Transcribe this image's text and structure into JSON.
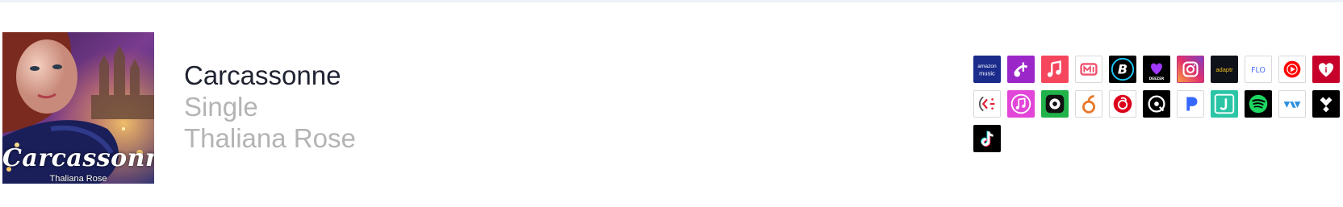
{
  "release": {
    "title": "Carcassonne",
    "type": "Single",
    "artist": "Thaliana Rose",
    "cover_title": "Carcassonne",
    "cover_artist": "Thaliana Rose"
  },
  "services": [
    {
      "name": "amazon-music-icon",
      "label_line1": "amazon",
      "label_line2": "music",
      "bg": "#1a2b8c",
      "fg": "#ffffff"
    },
    {
      "name": "anghami-icon",
      "bg": "#9c27c9",
      "fg": "#ffffff"
    },
    {
      "name": "apple-music-icon",
      "bg": "#f5465d",
      "fg": "#ffffff"
    },
    {
      "name": "audiomack-icon",
      "bg": "#ffffff",
      "fg": "#f0506e"
    },
    {
      "name": "boomplay-icon",
      "bg": "#000000",
      "fg": "#1ec8ff"
    },
    {
      "name": "deezer-icon",
      "label": "DEEZER",
      "bg": "#000000",
      "fg": "#a238ff"
    },
    {
      "name": "instagram-icon",
      "bg": "#c13584",
      "fg": "#ffffff"
    },
    {
      "name": "adaptr-icon",
      "label": "adaptr",
      "bg": "#10121a",
      "fg": "#f0c020"
    },
    {
      "name": "flo-icon",
      "label": "FLO",
      "bg": "#ffffff",
      "fg": "#4a6cf7"
    },
    {
      "name": "youtube-music-icon",
      "bg": "#ffffff",
      "fg": "#ff0000"
    },
    {
      "name": "iheartradio-icon",
      "bg": "#c6002b",
      "fg": "#ffffff"
    },
    {
      "name": "joox-icon",
      "bg": "#ffffff",
      "fg": "#e0233a"
    },
    {
      "name": "itunes-icon",
      "bg": "#e246d8",
      "fg": "#ffffff"
    },
    {
      "name": "kkbox-icon",
      "bg": "#1fb34a",
      "fg": "#111111"
    },
    {
      "name": "melon-icon",
      "bg": "#ffffff",
      "fg": "#e8782c"
    },
    {
      "name": "netease-music-icon",
      "bg": "#ffffff",
      "fg": "#dd001b"
    },
    {
      "name": "napster-icon",
      "bg": "#000000",
      "fg": "#ffffff"
    },
    {
      "name": "pandora-icon",
      "bg": "#ffffff",
      "fg": "#3668ff"
    },
    {
      "name": "jiosaavn-icon",
      "bg": "#2bc5a6",
      "fg": "#ffffff"
    },
    {
      "name": "spotify-icon",
      "bg": "#000000",
      "fg": "#1ed760"
    },
    {
      "name": "tidal-wave-icon",
      "bg": "#ffffff",
      "fg": "#2b8fe0"
    },
    {
      "name": "tidal-icon",
      "bg": "#000000",
      "fg": "#ffffff"
    },
    {
      "name": "tiktok-icon",
      "bg": "#000000",
      "fg": "#ffffff"
    }
  ]
}
